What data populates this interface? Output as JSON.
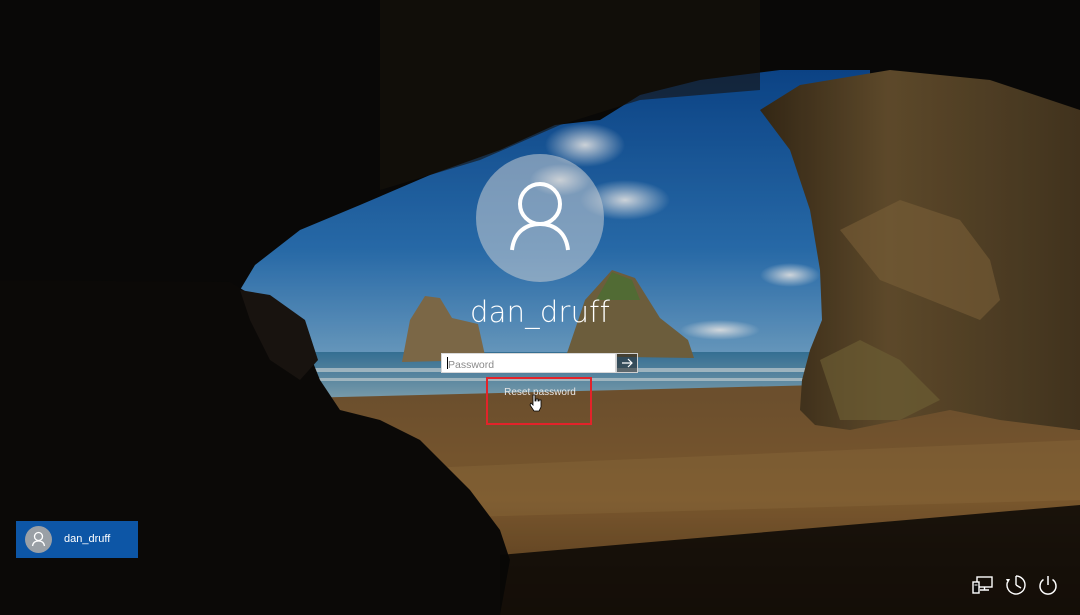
{
  "lockscreen": {
    "username": "dan_druff",
    "password_placeholder": "Password",
    "reset_password_label": "Reset password"
  },
  "user_switcher": {
    "users": [
      {
        "name": "dan_druff"
      }
    ]
  },
  "system_tray": {
    "icons": [
      "network-icon",
      "ease-of-access-icon",
      "power-icon"
    ]
  },
  "colors": {
    "tile_accent": "#0d56a6",
    "highlight_box": "#e3232a"
  }
}
